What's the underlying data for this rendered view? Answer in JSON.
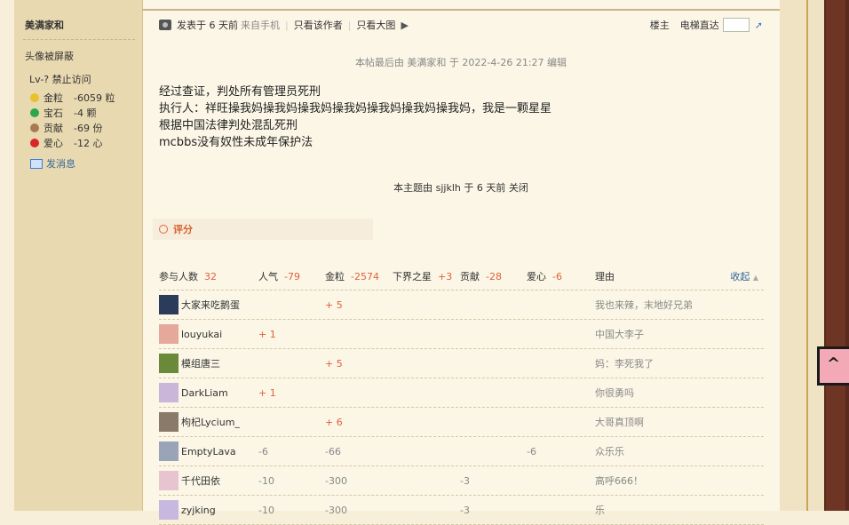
{
  "sidebar": {
    "username": "美满家和",
    "avatar_status": "头像被屏蔽",
    "level": "Lv-? 禁止访问",
    "stats": [
      {
        "label": "金粒",
        "value": "-6059 粒",
        "color": "#e8c22c"
      },
      {
        "label": "宝石",
        "value": "-4 颗",
        "color": "#2aa84a"
      },
      {
        "label": "贡献",
        "value": "-69 份",
        "color": "#a77a52"
      },
      {
        "label": "爱心",
        "value": "-12 心",
        "color": "#d8262a"
      }
    ],
    "message_link": "发消息"
  },
  "post": {
    "posted": "发表于 6 天前",
    "device": "来自手机",
    "only_author": "只看该作者",
    "only_image": "只看大图",
    "floor": "楼主",
    "elevator": "电梯直达",
    "edit_note": "本帖最后由 美满家和 于 2022-4-26 21:27 编辑",
    "lines": [
      "经过查证，判处所有管理员死刑",
      "执行人：祥旺操我妈操我妈操我妈操我妈操我妈操我妈操我妈，我是一颗星星",
      "根据中国法律判处混乱死刑",
      "mcbbs没有奴性未成年保护法"
    ],
    "closed_note": "本主题由 sjjklh 于 6 天前 关闭"
  },
  "rating": {
    "title": "评分",
    "headers": {
      "participants": "参与人数",
      "participants_count": "32",
      "popularity": "人气",
      "popularity_total": "-79",
      "gold": "金粒",
      "gold_total": "-2574",
      "star": "下界之星",
      "star_total": "+3",
      "contribution": "贡献",
      "contribution_total": "-28",
      "love": "爱心",
      "love_total": "-6",
      "reason": "理由",
      "collapse": "收起"
    },
    "rows": [
      {
        "user": "大家来吃鹅蛋",
        "popularity": "",
        "gold": "+ 5",
        "star": "",
        "contribution": "",
        "love": "",
        "reason": "我也来辣，末地好兄弟",
        "avatar": "#2b3b5b"
      },
      {
        "user": "louyukai",
        "popularity": "+ 1",
        "gold": "",
        "star": "",
        "contribution": "",
        "love": "",
        "reason": "中国大李子",
        "avatar": "#e6a89a"
      },
      {
        "user": "模组唐三",
        "popularity": "",
        "gold": "+ 5",
        "star": "",
        "contribution": "",
        "love": "",
        "reason": "妈：李死我了",
        "avatar": "#6a8a3a"
      },
      {
        "user": "DarkLiam",
        "popularity": "+ 1",
        "gold": "",
        "star": "",
        "contribution": "",
        "love": "",
        "reason": "你很勇吗",
        "avatar": "#c9b6d8"
      },
      {
        "user": "枸杞Lycium_",
        "popularity": "",
        "gold": "+ 6",
        "star": "",
        "contribution": "",
        "love": "",
        "reason": "大哥真顶啊",
        "avatar": "#8a7a6a"
      },
      {
        "user": "EmptyLava",
        "popularity": "-6",
        "gold": "-66",
        "star": "",
        "contribution": "",
        "love": "-6",
        "reason": "众乐乐",
        "avatar": "#9aa4b8"
      },
      {
        "user": "千代田依",
        "popularity": "-10",
        "gold": "-300",
        "star": "",
        "contribution": "-3",
        "love": "",
        "reason": "高呼666！",
        "avatar": "#e8c4d0"
      },
      {
        "user": "zyjking",
        "popularity": "-10",
        "gold": "-300",
        "star": "",
        "contribution": "-3",
        "love": "",
        "reason": "乐",
        "avatar": "#c8b8e0"
      }
    ]
  }
}
